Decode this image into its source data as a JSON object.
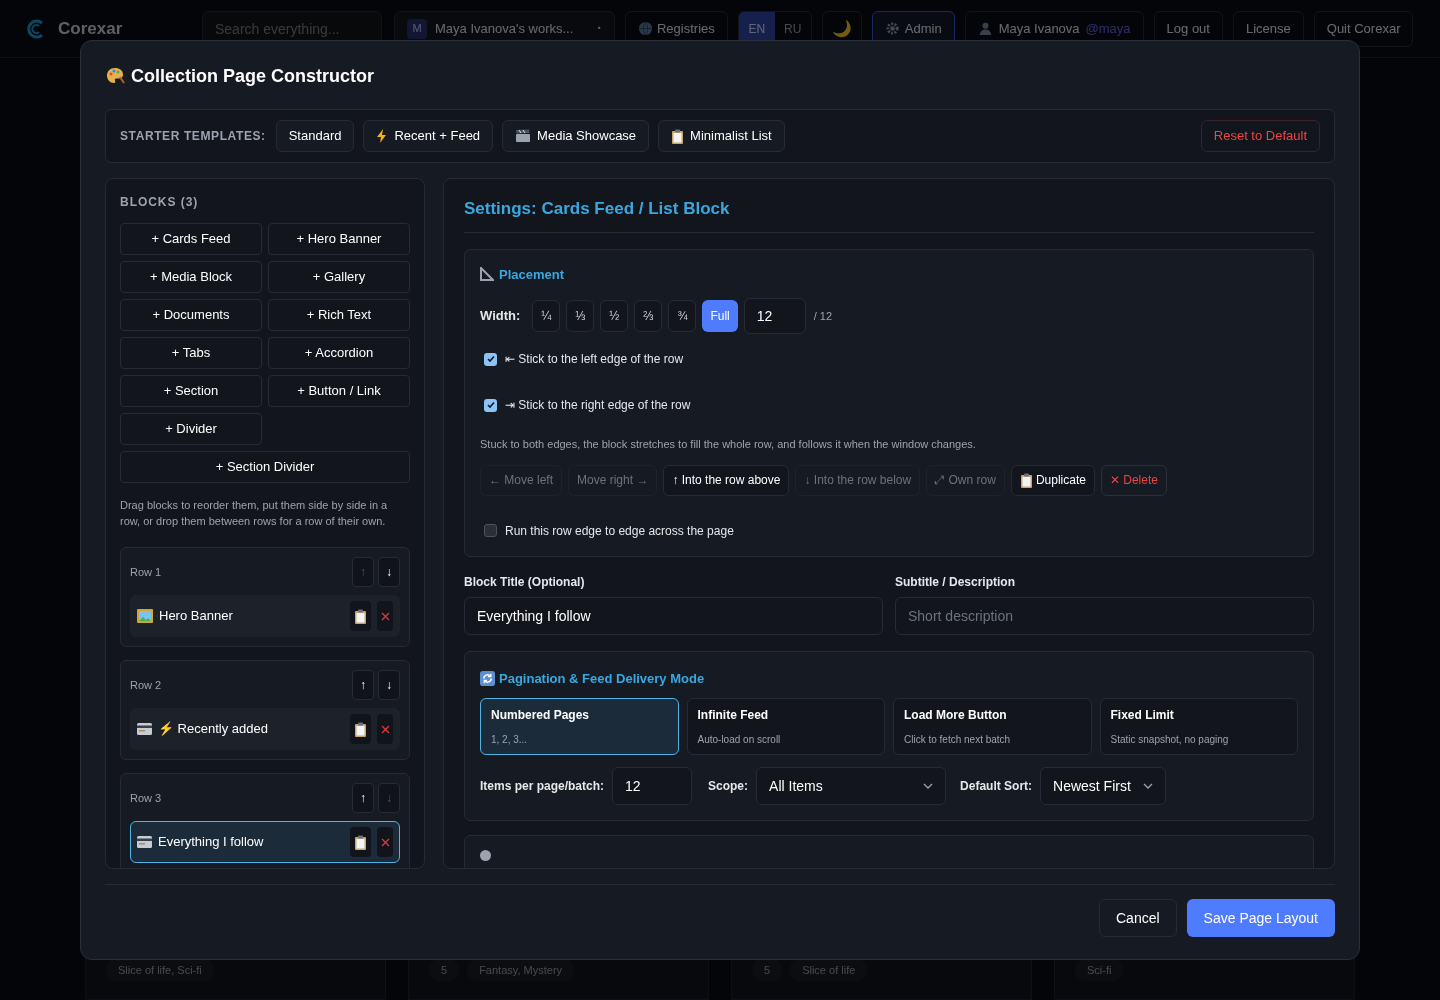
{
  "topbar": {
    "brand": "Corexar",
    "search": {
      "placeholder": "Search everything..."
    },
    "workspace": {
      "avatar": "M",
      "label": "Maya Ivanova's works...",
      "caret": "·"
    },
    "registries": "Registries",
    "languages": [
      {
        "label": "EN",
        "selected": true
      },
      {
        "label": "RU",
        "selected": false
      }
    ],
    "theme_toggle": "🌙",
    "admin": {
      "label": "Admin",
      "selected": true
    },
    "user": {
      "name": "Maya Ivanova",
      "handle": "@maya"
    },
    "buttons": [
      "Log out",
      "License",
      "Quit Corexar"
    ]
  },
  "background_cards": [
    {
      "chips": [
        "Slice of life, Sci-fi"
      ]
    },
    {
      "chips": [
        "5",
        "Fantasy, Mystery"
      ]
    },
    {
      "chips": [
        "5",
        "Slice of life"
      ]
    },
    {
      "chips": [
        "Sci-fi"
      ]
    }
  ],
  "modal": {
    "title": "Collection Page Constructor",
    "templates": {
      "label": "STARTER TEMPLATES:",
      "items": [
        "Standard",
        "Recent + Feed",
        "Media Showcase",
        "Minimalist List"
      ],
      "reset": "Reset to Default"
    },
    "blocks": {
      "heading": "BLOCKS (3)",
      "add_buttons": [
        {
          "label": "+ Cards Feed",
          "kind": "half"
        },
        {
          "label": "+ Hero Banner",
          "kind": "half"
        },
        {
          "label": "+ Media Block",
          "kind": "half"
        },
        {
          "label": "+ Gallery",
          "kind": "half"
        },
        {
          "label": "+ Documents",
          "kind": "half"
        },
        {
          "label": "+ Rich Text",
          "kind": "half"
        },
        {
          "label": "+ Tabs",
          "kind": "half"
        },
        {
          "label": "+ Accordion",
          "kind": "half"
        },
        {
          "label": "+ Section",
          "kind": "half"
        },
        {
          "label": "+ Button / Link",
          "kind": "half"
        },
        {
          "label": "+ Divider",
          "kind": "half"
        },
        {
          "label": "+ Section Divider",
          "kind": "full"
        }
      ],
      "hint": "Drag blocks to reorder them, put them side by side in a row, or drop them between rows for a row of their own.",
      "rows": [
        {
          "label": "Row 1",
          "up": {
            "label": "↑",
            "disabled": true
          },
          "down": {
            "label": "↓",
            "disabled": false
          },
          "items": [
            {
              "title": "Hero Banner",
              "kind": "banner",
              "selected": false
            }
          ]
        },
        {
          "label": "Row 2",
          "up": {
            "label": "↑",
            "disabled": false
          },
          "down": {
            "label": "↓",
            "disabled": false
          },
          "items": [
            {
              "title": "⚡ Recently added",
              "kind": "feed",
              "selected": false
            }
          ]
        },
        {
          "label": "Row 3",
          "up": {
            "label": "↑",
            "disabled": false
          },
          "down": {
            "label": "↓",
            "disabled": true
          },
          "items": [
            {
              "title": "Everything I follow",
              "kind": "feed",
              "selected": true
            }
          ]
        }
      ]
    },
    "settings": {
      "title": "Settings: Cards Feed / List Block",
      "placement": {
        "heading": "Placement",
        "width_label": "Width:",
        "widths": [
          {
            "label": "¼",
            "selected": false
          },
          {
            "label": "⅓",
            "selected": false
          },
          {
            "label": "½",
            "selected": false
          },
          {
            "label": "⅔",
            "selected": false
          },
          {
            "label": "¾",
            "selected": false
          },
          {
            "label": "Full",
            "selected": true
          }
        ],
        "columns": "12",
        "columns_total": "/ 12",
        "stick": [
          {
            "label": "⇤ Stick to the left edge of the row",
            "checked": true
          },
          {
            "label": "⇥ Stick to the right edge of the row",
            "checked": true
          }
        ],
        "note": "Stuck to both edges, the block stretches to fill the whole row, and follows it when the window changes.",
        "actions": [
          {
            "label": "← Move left",
            "kind": "plain",
            "disabled": true
          },
          {
            "label": "Move right →",
            "kind": "plain",
            "disabled": true
          },
          {
            "label": "↑ Into the row above",
            "kind": "plain",
            "disabled": false
          },
          {
            "label": "↓ Into the row below",
            "kind": "plain",
            "disabled": true
          },
          {
            "label": "⤢ Own row",
            "kind": "plain",
            "disabled": true
          },
          {
            "label": "Duplicate",
            "kind": "duplicate",
            "disabled": false
          },
          {
            "label": "✕ Delete",
            "kind": "danger",
            "disabled": false
          }
        ],
        "full_width": {
          "label": "Run this row edge to edge across the page",
          "checked": false
        }
      },
      "fields": [
        {
          "label": "Block Title (Optional)",
          "value": "Everything I follow"
        },
        {
          "label": "Subtitle / Description",
          "placeholder": "Short description"
        }
      ],
      "pagination": {
        "heading": "Pagination & Feed Delivery Mode",
        "modes": [
          {
            "title": "Numbered Pages",
            "caption": "1, 2, 3...",
            "selected": true
          },
          {
            "title": "Infinite Feed",
            "caption": "Auto-load on scroll",
            "selected": false
          },
          {
            "title": "Load More Button",
            "caption": "Click to fetch next batch",
            "selected": false
          },
          {
            "title": "Fixed Limit",
            "caption": "Static snapshot, no paging",
            "selected": false
          }
        ],
        "per_page": {
          "label": "Items per page/batch:",
          "value": "12"
        },
        "scope": {
          "label": "Scope:",
          "value": "All Items"
        },
        "sort": {
          "label": "Default Sort:",
          "value": "Newest First"
        }
      }
    },
    "footer": {
      "cancel": "Cancel",
      "save": "Save Page Layout"
    }
  }
}
